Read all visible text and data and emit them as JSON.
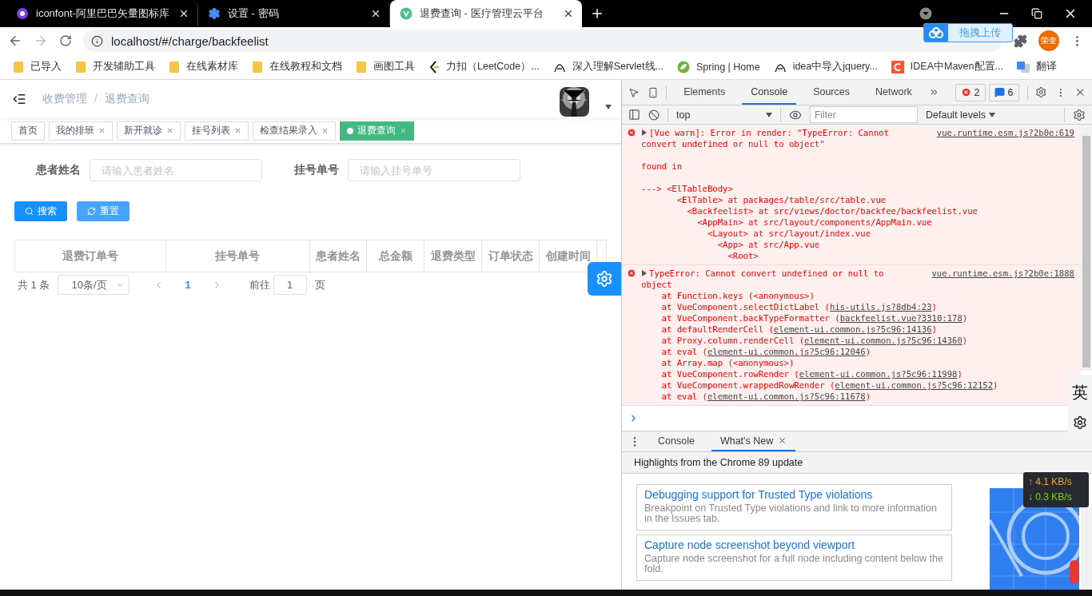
{
  "browser": {
    "tabs": [
      {
        "title": "iconfont-阿里巴巴矢量图标库",
        "selected": false,
        "kind": "iconfont"
      },
      {
        "title": "设置 - 密码",
        "selected": false,
        "kind": "settings"
      },
      {
        "title": "退费查询 - 医疗管理云平台",
        "selected": true,
        "kind": "vue"
      }
    ],
    "address": "localhost/#/charge/backfeelist",
    "upload_widget": "拖拽上传",
    "profile": "荣奎",
    "bookmarks": [
      {
        "label": "已导入",
        "kind": "folder"
      },
      {
        "label": "开发辅助工具",
        "kind": "folder"
      },
      {
        "label": "在线素材库",
        "kind": "folder"
      },
      {
        "label": "在线教程和文档",
        "kind": "folder"
      },
      {
        "label": "画图工具",
        "kind": "folder"
      },
      {
        "label": "力扣（LeetCode）...",
        "kind": "leetcode"
      },
      {
        "label": "深入理解Servlet线...",
        "kind": "blog"
      },
      {
        "label": "Spring | Home",
        "kind": "spring"
      },
      {
        "label": "idea中导入jquery...",
        "kind": "blog"
      },
      {
        "label": "IDEA中Maven配置...",
        "kind": "csdn"
      },
      {
        "label": "翻译",
        "kind": "translate"
      }
    ]
  },
  "app": {
    "breadcrumb": [
      "收费管理",
      "退费查询"
    ],
    "separator": "/",
    "tags": [
      {
        "label": "首页",
        "selected": false,
        "closable": false
      },
      {
        "label": "我的排班",
        "selected": false,
        "closable": true
      },
      {
        "label": "新开就诊",
        "selected": false,
        "closable": true
      },
      {
        "label": "挂号列表",
        "selected": false,
        "closable": true
      },
      {
        "label": "检查结果录入",
        "selected": false,
        "closable": true
      },
      {
        "label": "退费查询",
        "selected": true,
        "closable": true
      }
    ],
    "fields": [
      {
        "label": "患者姓名",
        "placeholder": "请输入患者姓名"
      },
      {
        "label": "挂号单号",
        "placeholder": "请输入挂号单号"
      }
    ],
    "buttons": [
      {
        "label": "搜索",
        "kind": "search"
      },
      {
        "label": "重置",
        "kind": "reset"
      }
    ],
    "table": {
      "columns": [
        "退费订单号",
        "挂号单号",
        "患者姓名",
        "总金额",
        "退费类型",
        "订单状态",
        "创建时间"
      ]
    },
    "pagination": {
      "total": "共 1 条",
      "page_size": "10条/页",
      "current_page": "1",
      "goto": "前往",
      "goto_value": "1",
      "page_unit": "页"
    }
  },
  "devtools": {
    "tabs": [
      {
        "label": "Elements",
        "selected": false
      },
      {
        "label": "Console",
        "selected": true
      },
      {
        "label": "Sources",
        "selected": false
      },
      {
        "label": "Network",
        "selected": false
      }
    ],
    "error_count": "2",
    "message_count": "6",
    "context": "top",
    "filter_placeholder": "Filter",
    "levels": "Default levels",
    "messages": [
      {
        "expanded": false,
        "text": "[Vue warn]: Error in render: \"TypeError: Cannot convert undefined or null to object\"",
        "source": "vue.runtime.esm.js?2b0e:619",
        "paragraphs": [
          [
            "found in"
          ],
          [
            "---> <ElTableBody>",
            "       <ElTable> at packages/table/src/table.vue",
            "         <Backfeelist> at src/views/doctor/backfee/backfeelist.vue",
            "           <AppMain> at src/layout/components/AppMain.vue",
            "             <Layout> at src/layout/index.vue",
            "               <App> at src/App.vue",
            "                 <Root>"
          ]
        ]
      },
      {
        "expanded": false,
        "text": "TypeError: Cannot convert undefined or null to object",
        "source": "vue.runtime.esm.js?2b0e:1888",
        "frames": [
          {
            "call": "at Function.keys (<anonymous>)"
          },
          {
            "call": "at VueComponent.selectDictLabel (",
            "link": "his-utils.js?8db4:23",
            "close": ")"
          },
          {
            "call": "at VueComponent.backTypeFormatter (",
            "link": "backfeelist.vue?3310:178",
            "close": ")"
          },
          {
            "call": "at defaultRenderCell (",
            "link": "element-ui.common.js?5c96:14136",
            "close": ")"
          },
          {
            "call": "at Proxy.column.renderCell (",
            "link": "element-ui.common.js?5c96:14360",
            "close": ")"
          },
          {
            "call": "at eval (",
            "link": "element-ui.common.js?5c96:12046",
            "close": ")"
          },
          {
            "call": "at Array.map (<anonymous>)"
          },
          {
            "call": "at VueComponent.rowRender (",
            "link": "element-ui.common.js?5c96:11998",
            "close": ")"
          },
          {
            "call": "at VueComponent.wrappedRowRender (",
            "link": "element-ui.common.js?5c96:12152",
            "close": ")"
          },
          {
            "call": "at eval (",
            "link": "element-ui.common.js?5c96:11678",
            "close": ")"
          }
        ]
      }
    ],
    "drawer_tabs": [
      {
        "label": "Console",
        "selected": false,
        "closable": false
      },
      {
        "label": "What's New",
        "selected": true,
        "closable": true
      }
    ],
    "whats_new_header": "Highlights from the Chrome 89 update",
    "cards": [
      {
        "title": "Debugging support for Trusted Type violations",
        "description": "Breakpoint on Trusted Type violations and link to more information in the Issues tab."
      },
      {
        "title": "Capture node screenshot beyond viewport",
        "description": "Capture node screenshot for a full node including content below the fold."
      }
    ]
  },
  "overlays": {
    "net_speed": {
      "up": "↑ 4.1 KB/s",
      "down": "↓ 0.3 KB/s"
    },
    "ime": "英"
  }
}
